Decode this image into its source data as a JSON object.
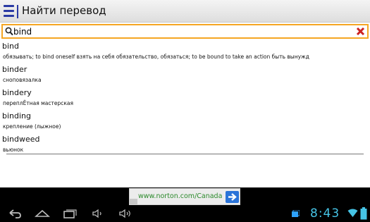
{
  "app": {
    "title": "Найти перевод"
  },
  "search": {
    "query": "bind"
  },
  "results": [
    {
      "word": "bind",
      "translation": "обязывать; to bind oneself взять на себя обязательство, обязаться; to be bound to take an action быть вынужд"
    },
    {
      "word": "binder",
      "translation": "сноповязалка"
    },
    {
      "word": "bindery",
      "translation": "переплЁтная мастерская"
    },
    {
      "word": "binding",
      "translation": "крепление (лыжное)"
    },
    {
      "word": "bindweed",
      "translation": "вьюнок"
    }
  ],
  "ad": {
    "text": "www.norton.com/Canada"
  },
  "status_bar": {
    "time": "8:43"
  },
  "colors": {
    "accent_blue": "#2a3aa4",
    "search_border": "#f5a623",
    "clear_red": "#cc2222",
    "clock": "#46c4e6",
    "ad_link": "#2c8a2c"
  }
}
